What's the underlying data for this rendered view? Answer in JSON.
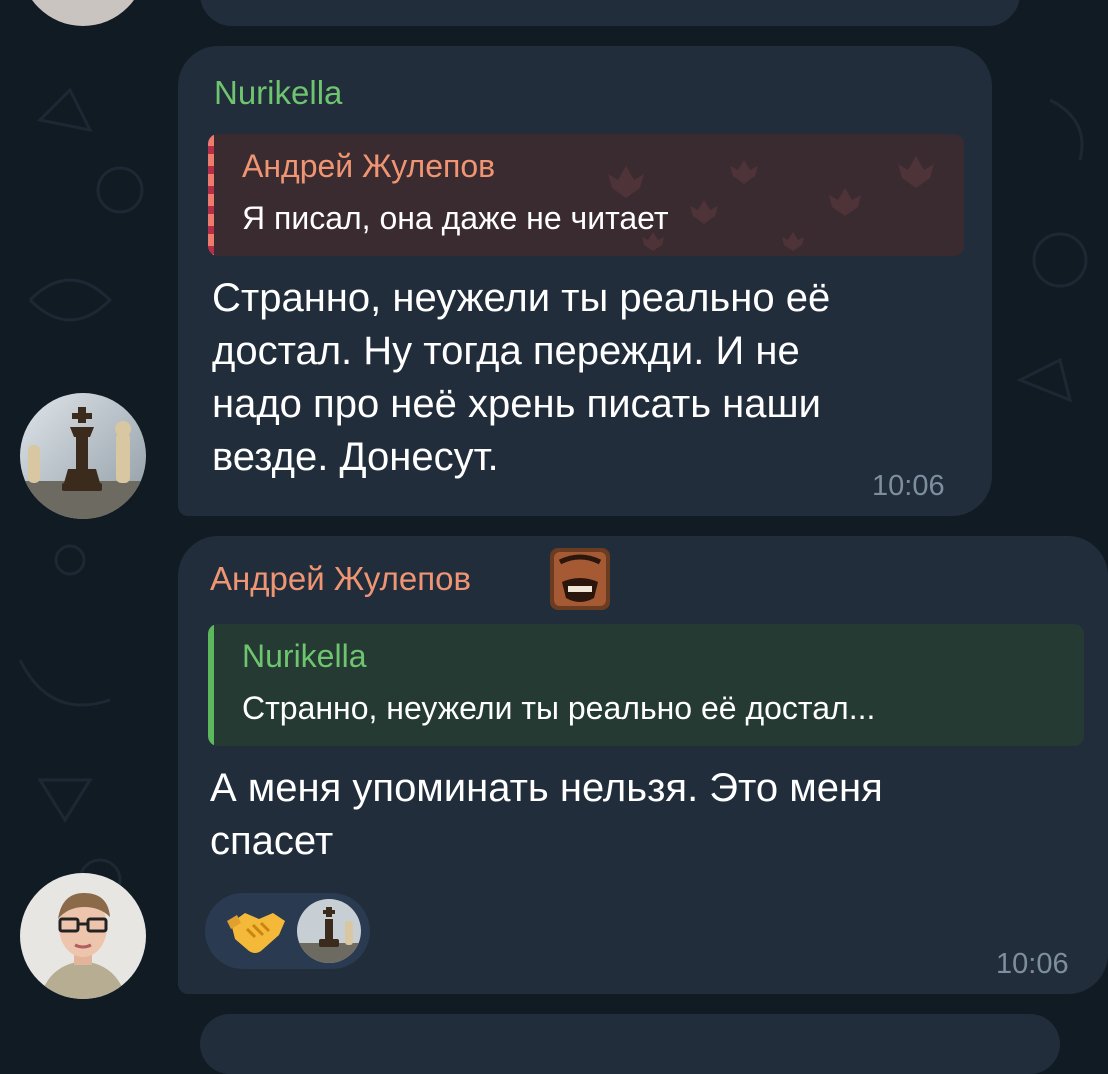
{
  "messages": [
    {
      "sender": "Nurikella",
      "reply": {
        "name": "Андрей Жулепов",
        "text": "Я писал, она даже не читает"
      },
      "body_lines": [
        "Странно, неужели ты реально её",
        "достал. Ну тогда пережди. И не",
        "надо про неё хрень писать наши",
        "везде. Донесут."
      ],
      "time": "10:06"
    },
    {
      "sender": "Андрей Жулепов",
      "reply": {
        "name": "Nurikella",
        "text": "Странно, неужели ты реально её достал..."
      },
      "body_lines": [
        "А меня упоминать нельзя. Это меня",
        "спасет"
      ],
      "time": "10:06",
      "reactions": [
        "handshake-emoji",
        "avatar-chess"
      ]
    }
  ],
  "colors": {
    "background": "#111b24",
    "bubble": "#212d3b",
    "green_name": "#6fc46f",
    "orange_name": "#ef9573"
  }
}
